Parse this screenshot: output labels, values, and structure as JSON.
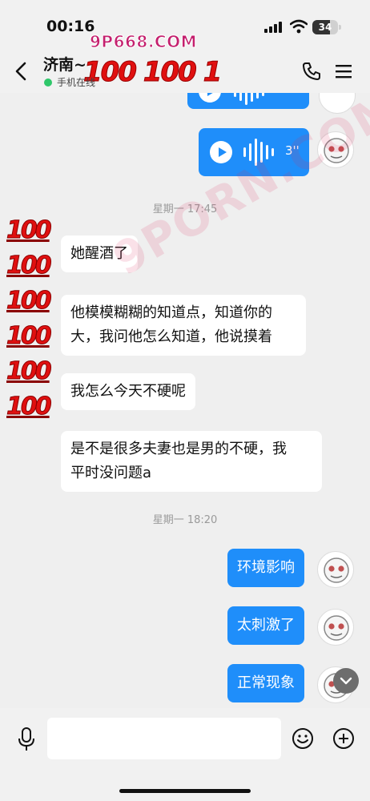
{
  "status_bar": {
    "time": "00:16",
    "watermark_site": "9P668.COM",
    "battery": "34"
  },
  "header": {
    "title": "济南~",
    "status": "手机在线",
    "title_decoration": "100 100 1"
  },
  "messages": {
    "voice_top": {
      "duration": ""
    },
    "voice_1": {
      "duration": "3''"
    },
    "timestamp_1": "星期一 17:45",
    "left_1": "她醒酒了",
    "left_2_line1": "他模模糊糊的知道点，知道你的",
    "left_2_line2": "大，我问他怎么知道，他说摸着",
    "left_3": "我怎么今天不硬呢",
    "left_4_line1": "是不是很多夫妻也是男的不硬，我",
    "left_4_line2": "平时没问题a",
    "timestamp_2": "星期一 18:20",
    "right_1": "环境影响",
    "right_2": "太刺激了",
    "right_3": "正常现象",
    "sticker_column": [
      "100",
      "100",
      "100",
      "100",
      "100",
      "100"
    ],
    "diagonal_watermark": "9PORN.COM"
  },
  "input": {
    "placeholder": ""
  },
  "colors": {
    "accent": "#1f8efa",
    "background": "#efefef",
    "online": "#2fc76a",
    "sticker_red": "#e01010"
  },
  "icons": [
    "chevron-left-icon",
    "phone-icon",
    "menu-icon",
    "play-icon",
    "microphone-icon",
    "emoji-icon",
    "plus-circle-icon",
    "chevron-down-icon"
  ]
}
